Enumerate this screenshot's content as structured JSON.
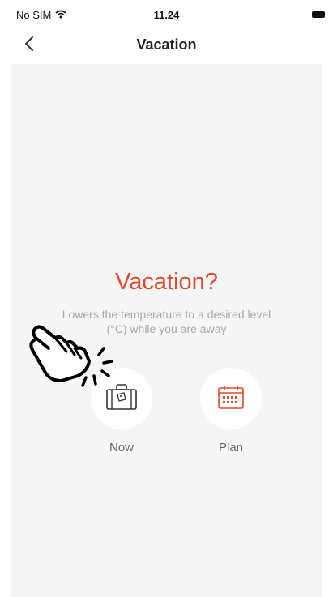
{
  "status_bar": {
    "carrier": "No SIM",
    "time": "11.24"
  },
  "nav": {
    "title": "Vacation",
    "back_icon": "chevron-left-icon"
  },
  "main": {
    "headline": "Vacation?",
    "description": "Lowers the temperature to a desired level (°C) while you are away",
    "options": [
      {
        "label": "Now",
        "icon": "suitcase-icon"
      },
      {
        "label": "Plan",
        "icon": "calendar-icon"
      }
    ]
  },
  "colors": {
    "accent": "#e0492b",
    "background": "#f5f5f5"
  }
}
